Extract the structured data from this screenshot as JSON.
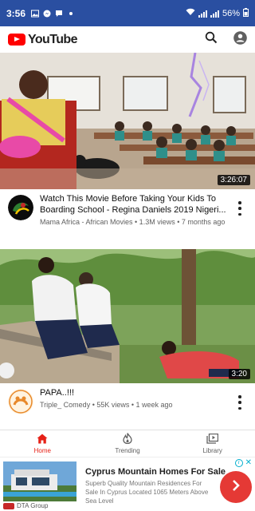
{
  "status_bar": {
    "time": "3:56",
    "battery": "56%"
  },
  "app_bar": {
    "logo_text": "YouTube"
  },
  "videos": [
    {
      "title": "Watch This Movie Before Taking Your Kids To Boarding School - Regina Daniels 2019 Nigeri...",
      "meta": "Mama Africa - African Movies • 1.3M views • 7 months ago",
      "duration": "3:26:07"
    },
    {
      "title": "PAPA..!!!",
      "meta": "Triple_ Comedy • 55K views • 1 week ago",
      "duration": "3:20"
    }
  ],
  "bottom_nav": {
    "items": [
      {
        "label": "Home",
        "icon": "home-icon",
        "active": true
      },
      {
        "label": "Trending",
        "icon": "flame-icon",
        "active": false
      },
      {
        "label": "Library",
        "icon": "library-icon",
        "active": false
      }
    ]
  },
  "ad": {
    "headline": "Cyprus Mountain Homes For Sale",
    "body": "Superb Quality Mountain Residences For Sale In Cyprus Located 1065 Meters Above Sea Level",
    "advertiser": "DTA Group"
  },
  "colors": {
    "status_bar": "#2a4fa1",
    "youtube_red": "#ff0000",
    "active_tab": "#e62117",
    "ad_button": "#e53935"
  }
}
